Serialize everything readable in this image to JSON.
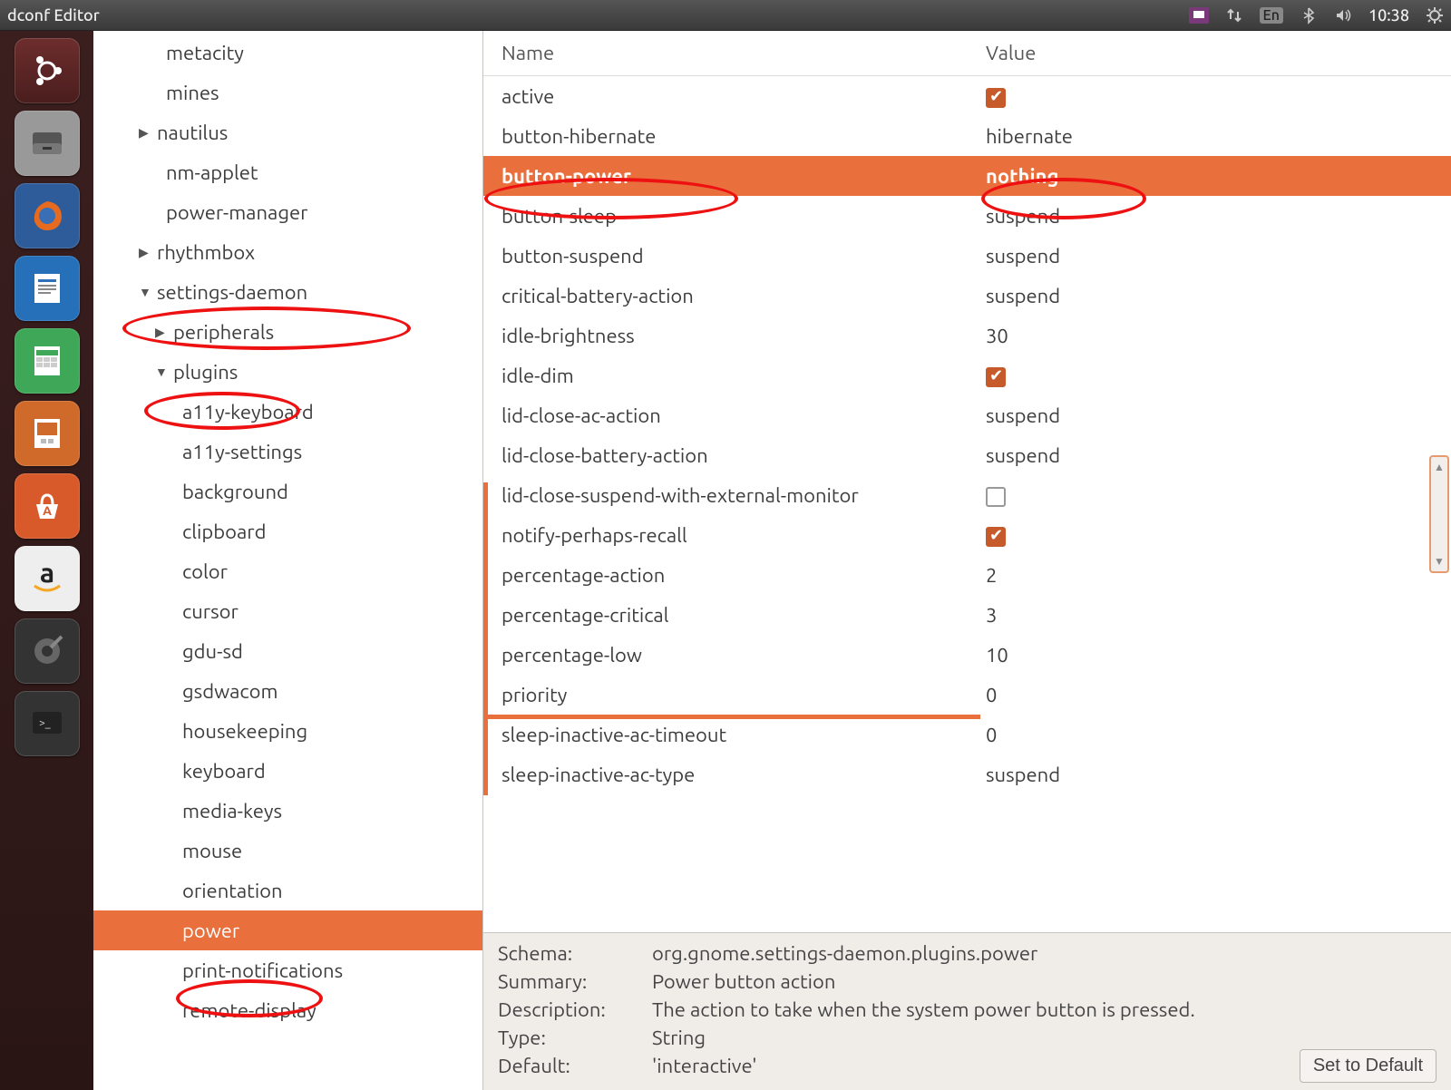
{
  "menubar": {
    "title": "dconf Editor",
    "lang": "En",
    "clock": "10:38"
  },
  "launcher": {
    "items": [
      {
        "name": "dash",
        "glyph": "◎"
      },
      {
        "name": "files",
        "glyph": "🗄"
      },
      {
        "name": "firefox",
        "glyph": "🦊"
      },
      {
        "name": "writer",
        "glyph": "📄"
      },
      {
        "name": "calc",
        "glyph": "📊"
      },
      {
        "name": "impress",
        "glyph": "📽"
      },
      {
        "name": "software",
        "glyph": "🛍"
      },
      {
        "name": "amazon",
        "glyph": "a"
      },
      {
        "name": "terminal",
        "glyph": ">_"
      }
    ]
  },
  "tree": [
    {
      "label": "metacity",
      "indent": 1,
      "arrow": ""
    },
    {
      "label": "mines",
      "indent": 1,
      "arrow": ""
    },
    {
      "label": "nautilus",
      "indent": 2,
      "arrow": "▶"
    },
    {
      "label": "nm-applet",
      "indent": 1,
      "arrow": ""
    },
    {
      "label": "power-manager",
      "indent": 1,
      "arrow": ""
    },
    {
      "label": "rhythmbox",
      "indent": 2,
      "arrow": "▶"
    },
    {
      "label": "settings-daemon",
      "indent": 2,
      "arrow": "▼"
    },
    {
      "label": "peripherals",
      "indent": 3,
      "arrow": "▶"
    },
    {
      "label": "plugins",
      "indent": 3,
      "arrow": "▼"
    },
    {
      "label": "a11y-keyboard",
      "indent": 4,
      "arrow": ""
    },
    {
      "label": "a11y-settings",
      "indent": 4,
      "arrow": ""
    },
    {
      "label": "background",
      "indent": 4,
      "arrow": ""
    },
    {
      "label": "clipboard",
      "indent": 4,
      "arrow": ""
    },
    {
      "label": "color",
      "indent": 4,
      "arrow": ""
    },
    {
      "label": "cursor",
      "indent": 4,
      "arrow": ""
    },
    {
      "label": "gdu-sd",
      "indent": 4,
      "arrow": ""
    },
    {
      "label": "gsdwacom",
      "indent": 4,
      "arrow": ""
    },
    {
      "label": "housekeeping",
      "indent": 4,
      "arrow": ""
    },
    {
      "label": "keyboard",
      "indent": 4,
      "arrow": ""
    },
    {
      "label": "media-keys",
      "indent": 4,
      "arrow": ""
    },
    {
      "label": "mouse",
      "indent": 4,
      "arrow": ""
    },
    {
      "label": "orientation",
      "indent": 4,
      "arrow": ""
    },
    {
      "label": "power",
      "indent": 4,
      "arrow": "",
      "selected": true
    },
    {
      "label": "print-notifications",
      "indent": 4,
      "arrow": ""
    },
    {
      "label": "remote-display",
      "indent": 4,
      "arrow": ""
    }
  ],
  "columns": {
    "name": "Name",
    "value": "Value"
  },
  "keys": [
    {
      "name": "active",
      "value_type": "check",
      "value": true
    },
    {
      "name": "button-hibernate",
      "value_type": "text",
      "value": "hibernate"
    },
    {
      "name": "button-power",
      "value_type": "text",
      "value": "nothing",
      "selected": true
    },
    {
      "name": "button-sleep",
      "value_type": "text",
      "value": "suspend"
    },
    {
      "name": "button-suspend",
      "value_type": "text",
      "value": "suspend"
    },
    {
      "name": "critical-battery-action",
      "value_type": "text",
      "value": "suspend"
    },
    {
      "name": "idle-brightness",
      "value_type": "text",
      "value": "30"
    },
    {
      "name": "idle-dim",
      "value_type": "check",
      "value": true
    },
    {
      "name": "lid-close-ac-action",
      "value_type": "text",
      "value": "suspend"
    },
    {
      "name": "lid-close-battery-action",
      "value_type": "text",
      "value": "suspend"
    },
    {
      "name": "lid-close-suspend-with-external-monitor",
      "value_type": "check",
      "value": false
    },
    {
      "name": "notify-perhaps-recall",
      "value_type": "check",
      "value": true
    },
    {
      "name": "percentage-action",
      "value_type": "text",
      "value": "2"
    },
    {
      "name": "percentage-critical",
      "value_type": "text",
      "value": "3"
    },
    {
      "name": "percentage-low",
      "value_type": "text",
      "value": "10"
    },
    {
      "name": "priority",
      "value_type": "text",
      "value": "0"
    },
    {
      "name": "sleep-inactive-ac-timeout",
      "value_type": "text",
      "value": "0"
    },
    {
      "name": "sleep-inactive-ac-type",
      "value_type": "text",
      "value": "suspend"
    }
  ],
  "details": {
    "schema_label": "Schema:",
    "schema": "org.gnome.settings-daemon.plugins.power",
    "summary_label": "Summary:",
    "summary": "Power button action",
    "description_label": "Description:",
    "description": "The action to take when the system power button is pressed.",
    "type_label": "Type:",
    "type": "String",
    "default_label": "Default:",
    "default": "'interactive'",
    "set_default": "Set to Default"
  }
}
